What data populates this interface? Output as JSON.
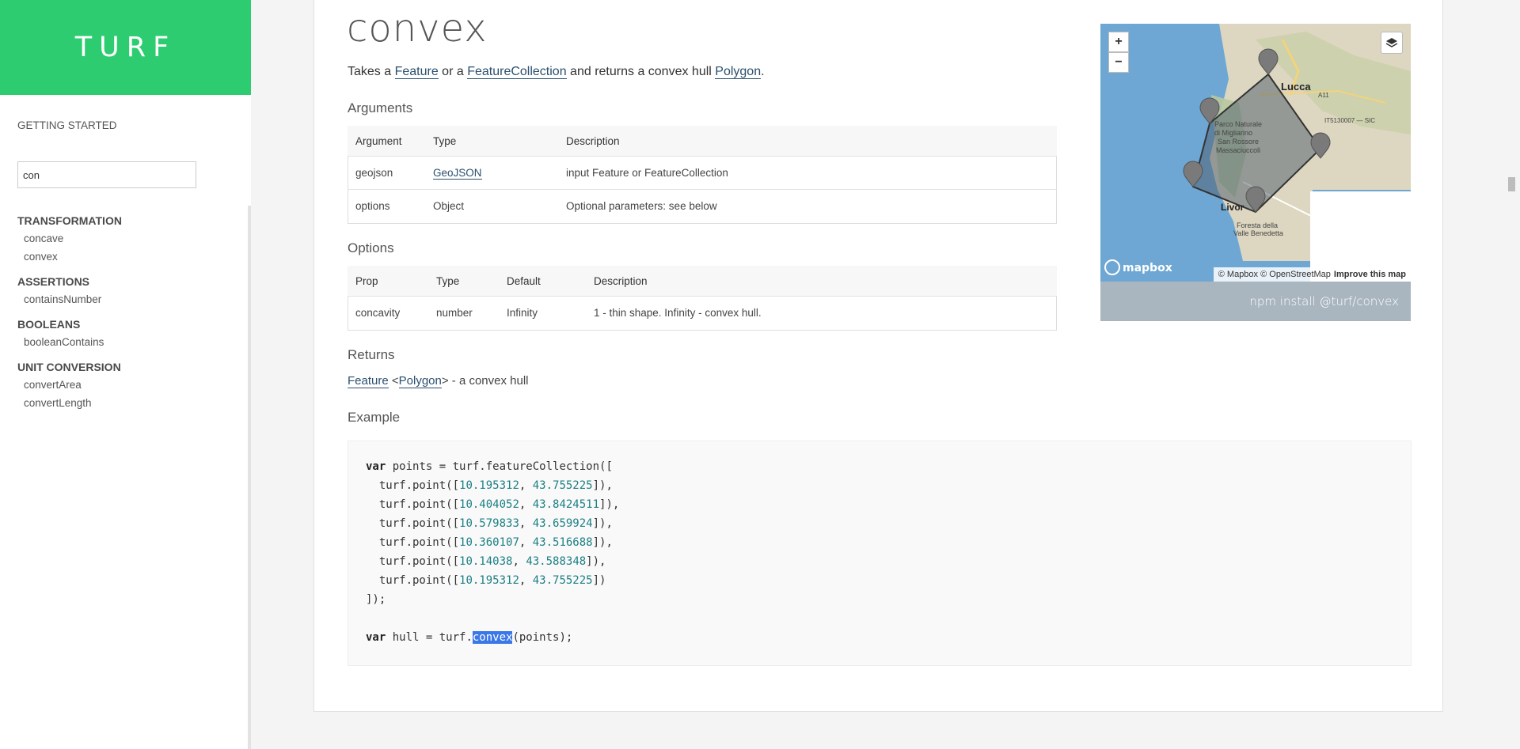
{
  "brand": "TURF",
  "sidebar": {
    "getting_started": "GETTING STARTED",
    "search_value": "con",
    "groups": [
      {
        "heading": "TRANSFORMATION",
        "items": [
          "concave",
          "convex"
        ]
      },
      {
        "heading": "ASSERTIONS",
        "items": [
          "containsNumber"
        ]
      },
      {
        "heading": "BOOLEANS",
        "items": [
          "booleanContains"
        ]
      },
      {
        "heading": "UNIT CONVERSION",
        "items": [
          "convertArea",
          "convertLength"
        ]
      }
    ]
  },
  "doc": {
    "title": "convex",
    "summary": {
      "t1": "Takes a ",
      "link1": "Feature",
      "t2": " or a ",
      "link2": "FeatureCollection",
      "t3": " and returns a convex hull ",
      "link3": "Polygon",
      "t4": "."
    },
    "arguments_heading": "Arguments",
    "arguments": {
      "headers": [
        "Argument",
        "Type",
        "Description"
      ],
      "rows": [
        [
          "geojson",
          "GeoJSON",
          "input Feature or FeatureCollection"
        ],
        [
          "options",
          "Object",
          "Optional parameters: see below"
        ]
      ]
    },
    "options_heading": "Options",
    "options": {
      "headers": [
        "Prop",
        "Type",
        "Default",
        "Description"
      ],
      "rows": [
        [
          "concavity",
          "number",
          "Infinity",
          "1 - thin shape. Infinity - convex hull."
        ]
      ]
    },
    "returns_heading": "Returns",
    "returns": {
      "link1": "Feature",
      "lt": " <",
      "link2": "Polygon",
      "rest": "> - a convex hull"
    },
    "example_heading": "Example"
  },
  "map": {
    "zoom_in": "+",
    "zoom_out": "−",
    "labels": {
      "lucca": "Lucca",
      "a11": "A11",
      "sic": "IT5130007 — SIC",
      "park1": "Parco Naturale",
      "park2": "di Migliarino",
      "park3": "San Rossore",
      "park4": "Massaciuccoli",
      "livorno": "Livor",
      "forest1": "Foresta della",
      "forest2": "Valle Benedetta"
    },
    "logo": "mapbox",
    "attribution": "© Mapbox © OpenStreetMap",
    "improve": "Improve this map"
  },
  "install": "npm install @turf/convex",
  "code": {
    "l1_kw": "var",
    "l1": " points = turf.featureCollection([",
    "points": [
      [
        "10.195312",
        "43.755225"
      ],
      [
        "10.404052",
        "43.8424511"
      ],
      [
        "10.579833",
        "43.659924"
      ],
      [
        "10.360107",
        "43.516688"
      ],
      [
        "10.14038",
        "43.588348"
      ],
      [
        "10.195312",
        "43.755225"
      ]
    ],
    "close": "]);",
    "hull_kw": "var",
    "hull_pre": " hull = turf.",
    "hull_fn": "convex",
    "hull_post": "(points);"
  }
}
